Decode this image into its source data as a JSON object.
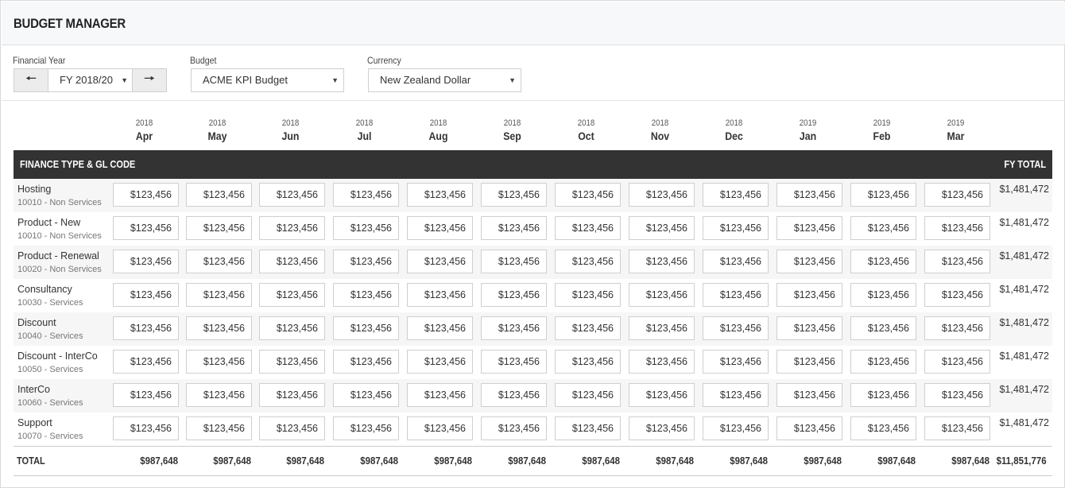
{
  "app": {
    "title": "BUDGET MANAGER"
  },
  "filters": {
    "financial_year": {
      "label": "Financial Year",
      "value": "FY 2018/20"
    },
    "budget": {
      "label": "Budget",
      "value": "ACME KPI Budget"
    },
    "currency": {
      "label": "Currency",
      "value": "New Zealand Dollar"
    }
  },
  "months": [
    {
      "year": "2018",
      "month": "Apr"
    },
    {
      "year": "2018",
      "month": "May"
    },
    {
      "year": "2018",
      "month": "Jun"
    },
    {
      "year": "2018",
      "month": "Jul"
    },
    {
      "year": "2018",
      "month": "Aug"
    },
    {
      "year": "2018",
      "month": "Sep"
    },
    {
      "year": "2018",
      "month": "Oct"
    },
    {
      "year": "2018",
      "month": "Nov"
    },
    {
      "year": "2018",
      "month": "Dec"
    },
    {
      "year": "2019",
      "month": "Jan"
    },
    {
      "year": "2019",
      "month": "Feb"
    },
    {
      "year": "2019",
      "month": "Mar"
    }
  ],
  "table": {
    "header_left": "FINANCE TYPE & GL CODE",
    "header_right": "FY TOTAL",
    "rows": [
      {
        "name": "Hosting",
        "code": "10010 - Non Services",
        "values": [
          "$123,456",
          "$123,456",
          "$123,456",
          "$123,456",
          "$123,456",
          "$123,456",
          "$123,456",
          "$123,456",
          "$123,456",
          "$123,456",
          "$123,456",
          "$123,456"
        ],
        "total": "$1,481,472"
      },
      {
        "name": "Product - New",
        "code": "10010 - Non Services",
        "values": [
          "$123,456",
          "$123,456",
          "$123,456",
          "$123,456",
          "$123,456",
          "$123,456",
          "$123,456",
          "$123,456",
          "$123,456",
          "$123,456",
          "$123,456",
          "$123,456"
        ],
        "total": "$1,481,472"
      },
      {
        "name": "Product - Renewal",
        "code": "10020 - Non Services",
        "values": [
          "$123,456",
          "$123,456",
          "$123,456",
          "$123,456",
          "$123,456",
          "$123,456",
          "$123,456",
          "$123,456",
          "$123,456",
          "$123,456",
          "$123,456",
          "$123,456"
        ],
        "total": "$1,481,472"
      },
      {
        "name": "Consultancy",
        "code": "10030 - Services",
        "values": [
          "$123,456",
          "$123,456",
          "$123,456",
          "$123,456",
          "$123,456",
          "$123,456",
          "$123,456",
          "$123,456",
          "$123,456",
          "$123,456",
          "$123,456",
          "$123,456"
        ],
        "total": "$1,481,472"
      },
      {
        "name": "Discount",
        "code": "10040 - Services",
        "values": [
          "$123,456",
          "$123,456",
          "$123,456",
          "$123,456",
          "$123,456",
          "$123,456",
          "$123,456",
          "$123,456",
          "$123,456",
          "$123,456",
          "$123,456",
          "$123,456"
        ],
        "total": "$1,481,472"
      },
      {
        "name": "Discount - InterCo",
        "code": "10050 - Services",
        "values": [
          "$123,456",
          "$123,456",
          "$123,456",
          "$123,456",
          "$123,456",
          "$123,456",
          "$123,456",
          "$123,456",
          "$123,456",
          "$123,456",
          "$123,456",
          "$123,456"
        ],
        "total": "$1,481,472"
      },
      {
        "name": "InterCo",
        "code": "10060 - Services",
        "values": [
          "$123,456",
          "$123,456",
          "$123,456",
          "$123,456",
          "$123,456",
          "$123,456",
          "$123,456",
          "$123,456",
          "$123,456",
          "$123,456",
          "$123,456",
          "$123,456"
        ],
        "total": "$1,481,472"
      },
      {
        "name": "Support",
        "code": "10070 - Services",
        "values": [
          "$123,456",
          "$123,456",
          "$123,456",
          "$123,456",
          "$123,456",
          "$123,456",
          "$123,456",
          "$123,456",
          "$123,456",
          "$123,456",
          "$123,456",
          "$123,456"
        ],
        "total": "$1,481,472"
      }
    ],
    "totals": {
      "label": "TOTAL",
      "values": [
        "$987,648",
        "$987,648",
        "$987,648",
        "$987,648",
        "$987,648",
        "$987,648",
        "$987,648",
        "$987,648",
        "$987,648",
        "$987,648",
        "$987,648",
        "$987,648"
      ],
      "grand_total": "$11,851,776"
    }
  },
  "icons": {
    "prev": "arrow-left-icon",
    "next": "arrow-right-icon",
    "caret": "caret-down-icon"
  }
}
